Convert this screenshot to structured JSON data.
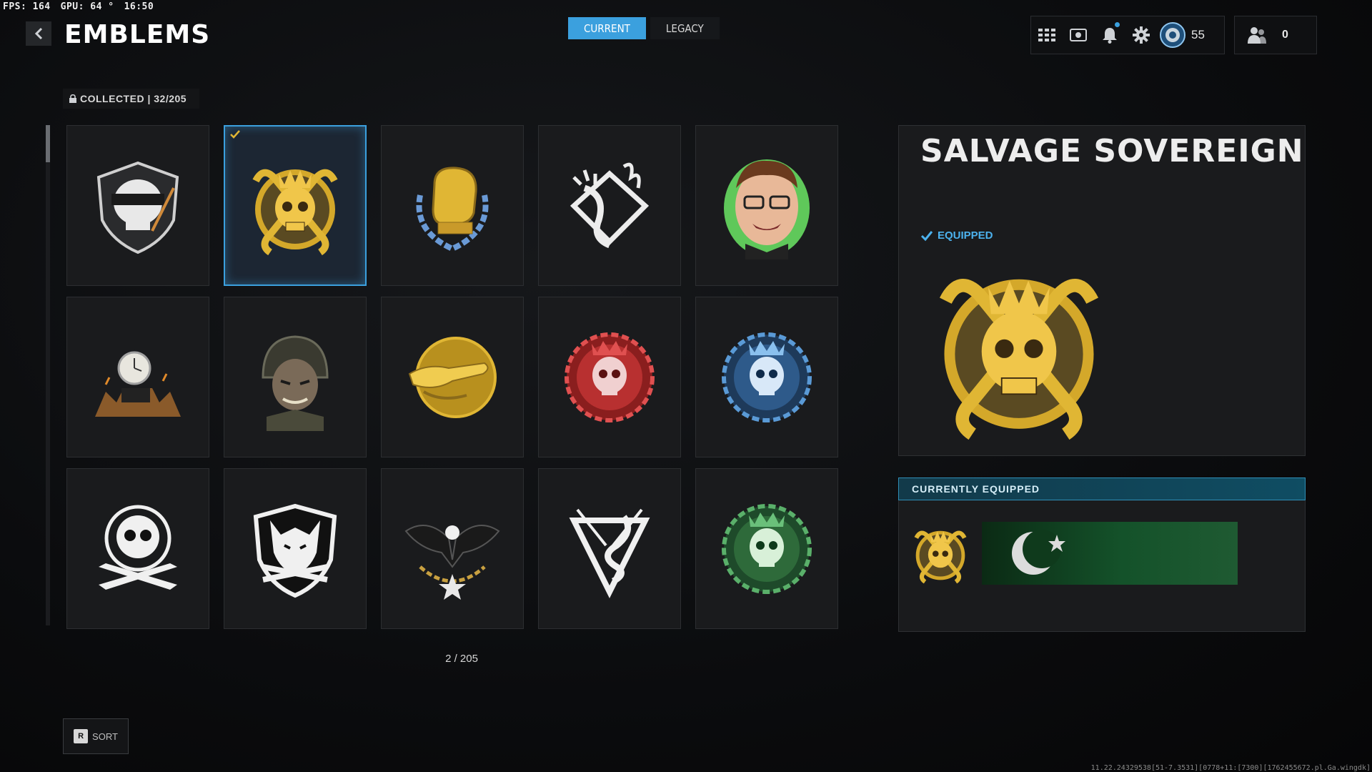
{
  "hud": {
    "fps": "FPS: 164",
    "gpu": "GPU: 64 °",
    "time": "16:50"
  },
  "header": {
    "title": "EMBLEMS"
  },
  "tabs": [
    {
      "label": "CURRENT",
      "active": true
    },
    {
      "label": "LEGACY",
      "active": false
    }
  ],
  "topbar": {
    "level": "55",
    "friends_count": "0",
    "icons": [
      "apps-grid-icon",
      "media-icon",
      "bell-icon",
      "gear-icon",
      "rank-badge-icon",
      "friends-icon"
    ]
  },
  "collection": {
    "label": "COLLECTED | 32/205"
  },
  "grid": {
    "emblems": [
      {
        "name": "masked-skull-emblem",
        "color": "#d8d8d8"
      },
      {
        "name": "salvage-sovereign-emblem",
        "color": "#d4a82a",
        "selected": true
      },
      {
        "name": "boxing-glove-emblem",
        "color": "#d4a82a"
      },
      {
        "name": "flaming-claw-emblem",
        "color": "#e8e8e8"
      },
      {
        "name": "cartoon-face-emblem",
        "color": "#6fd06a"
      },
      {
        "name": "clock-tower-emblem",
        "color": "#c8b27a"
      },
      {
        "name": "soldier-helmet-emblem",
        "color": "#8a8a7a"
      },
      {
        "name": "gold-alligator-emblem",
        "color": "#d4a82a"
      },
      {
        "name": "red-skull-gear-emblem",
        "color": "#d84848"
      },
      {
        "name": "blue-skull-gear-emblem",
        "color": "#4a86c8"
      },
      {
        "name": "skull-bullets-emblem",
        "color": "#f0f0f0"
      },
      {
        "name": "wolf-shield-emblem",
        "color": "#f0f0f0"
      },
      {
        "name": "eagle-star-emblem",
        "color": "#c8a040"
      },
      {
        "name": "snake-arrows-emblem",
        "color": "#f0f0f0"
      },
      {
        "name": "green-skull-gear-emblem",
        "color": "#4fa05a"
      }
    ],
    "counter": "2 / 205"
  },
  "sort": {
    "key": "R",
    "label": "SORT"
  },
  "detail": {
    "name": "SALVAGE SOVEREIGN",
    "equipped_label": "EQUIPPED"
  },
  "currently_equipped": {
    "header": "CURRENTLY EQUIPPED"
  },
  "build_string": "11.22.24329538[51-7.3531][0778+11:[7300][1762455672.pl.Ga.wingdk]",
  "colors": {
    "accent": "#3ba0de",
    "gold": "#d4a82a",
    "panel": "#1a1b1d",
    "background": "#0b0c0e"
  }
}
